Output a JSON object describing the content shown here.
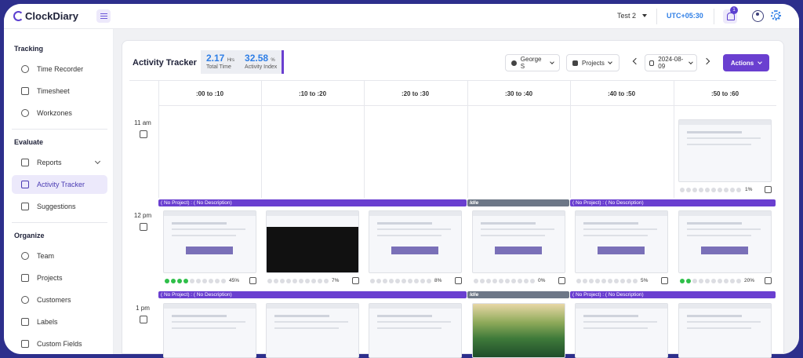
{
  "app": {
    "logo": "ClockDiary"
  },
  "topbar": {
    "workspace": "Test 2",
    "timezone": "UTC+05:30",
    "notifications": "1"
  },
  "sidebar": {
    "sections": [
      {
        "title": "Tracking",
        "items": [
          "Time Recorder",
          "Timesheet",
          "Workzones"
        ]
      },
      {
        "title": "Evaluate",
        "items": [
          "Reports",
          "Activity Tracker",
          "Suggestions"
        ]
      },
      {
        "title": "Organize",
        "items": [
          "Team",
          "Projects",
          "Customers",
          "Labels",
          "Custom Fields"
        ]
      }
    ],
    "active": "Activity Tracker"
  },
  "header": {
    "title": "Activity Tracker",
    "total_time_value": "2.17",
    "total_time_unit": "Hrs",
    "total_time_label": "Total Time",
    "activity_index_value": "32.58",
    "activity_index_unit": "%",
    "activity_index_label": "Activity Index",
    "user_filter": "George S",
    "project_filter": "Projects",
    "date": "2024-08-09",
    "actions_label": "Actions"
  },
  "grid": {
    "columns": [
      ":00 to :10",
      ":10 to :20",
      ":20 to :30",
      ":30 to :40",
      ":40 to :50",
      ":50 to :60"
    ],
    "hours": [
      "11 am",
      "12 pm",
      "1 pm"
    ],
    "bars_row1": [
      {
        "label": "( No Project) : ( No Description)",
        "type": "proj"
      },
      {
        "label": "Idle",
        "type": "idle"
      },
      {
        "label": "( No Project) : ( No Description)",
        "type": "proj"
      }
    ],
    "bars_row2": [
      {
        "label": "( No Project) : ( No Description)",
        "type": "proj"
      },
      {
        "label": "Idle",
        "type": "idle"
      },
      {
        "label": "( No Project) : ( No Description)",
        "type": "proj"
      }
    ],
    "row0_percent": "1%",
    "row1_percents": [
      "45%",
      "7%",
      "8%",
      "0%",
      "5%",
      "20%"
    ],
    "row0_activity": 0,
    "row1_activity_dots": [
      4,
      0,
      0,
      0,
      0,
      2
    ]
  }
}
